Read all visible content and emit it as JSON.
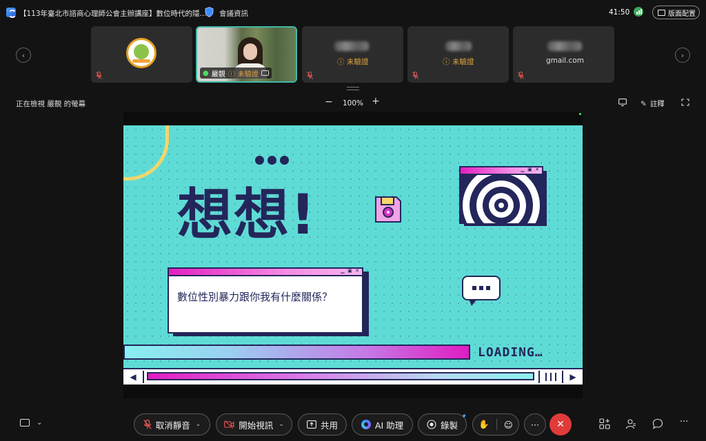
{
  "window": {
    "title": "【113年臺北市諮商心理師公會主辦講座】數位時代的隱...",
    "meeting_info": "會議資訊",
    "timer": "41:50",
    "layout_button": "版面配置"
  },
  "participants": [
    {
      "name": "",
      "kind": "logo",
      "muted": true
    },
    {
      "name": "嚴靚",
      "status": "未驗證",
      "kind": "video",
      "active": true
    },
    {
      "name": "",
      "status": "未驗證",
      "kind": "blurred",
      "muted": true
    },
    {
      "name": "",
      "status": "未驗證",
      "kind": "blurred",
      "muted": true
    },
    {
      "name": "gmail.com",
      "kind": "blurred",
      "muted": true
    }
  ],
  "view_bar": {
    "viewing_text": "正在檢視 嚴靚 的螢幕",
    "zoom_minus": "−",
    "zoom": "100%",
    "zoom_plus": "+",
    "annotate": "註釋"
  },
  "slide": {
    "title": "想想!",
    "question": "數位性別暴力跟你我有什麼關係？",
    "loading_text": "LOADING…",
    "scroll_left": "◀",
    "scroll_right": "▶"
  },
  "controls": {
    "mute": "取消靜音",
    "video": "開始視訊",
    "share": "共用",
    "ai": "AI 助理",
    "record": "錄製",
    "more": "···",
    "end": "✕"
  },
  "colors": {
    "accent": "#3fb9a9",
    "slide_bg": "#5fdbd6",
    "slide_ink": "#23265a",
    "magenta": "#e11cc1",
    "end_red": "#e03b3b",
    "warning": "#e0a33c"
  }
}
